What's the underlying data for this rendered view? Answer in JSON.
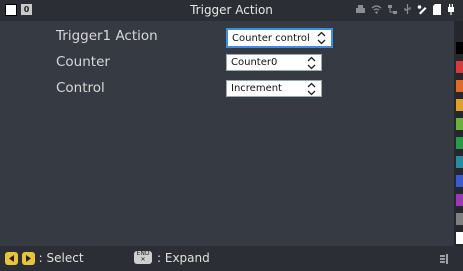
{
  "header": {
    "title": "Trigger Action",
    "badge": "0",
    "status_icons": [
      "printer-icon",
      "wifi-icon",
      "network-icon",
      "usb-icon",
      "pen-icon",
      "sd-card-icon",
      "power-plug-icon"
    ]
  },
  "form": {
    "rows": [
      {
        "label": "Trigger1  Action",
        "value": "Counter control"
      },
      {
        "label": "Counter",
        "value": "Counter0"
      },
      {
        "label": "Control",
        "value": "Increment"
      }
    ]
  },
  "sidebar": {
    "colors": [
      "#000000",
      "#d63a3a",
      "#e06a2a",
      "#e0a030",
      "#6bb03a",
      "#2a9a4a",
      "#2a8aa0",
      "#3a5ad0",
      "#9a3ab0",
      "#808080",
      "#ffffff"
    ]
  },
  "footer": {
    "select_label": ": Select",
    "end_key": "END",
    "expand_label": ": Expand"
  },
  "colors": {
    "accent": "#3a8fe0",
    "key_yellow": "#e6c53a"
  }
}
